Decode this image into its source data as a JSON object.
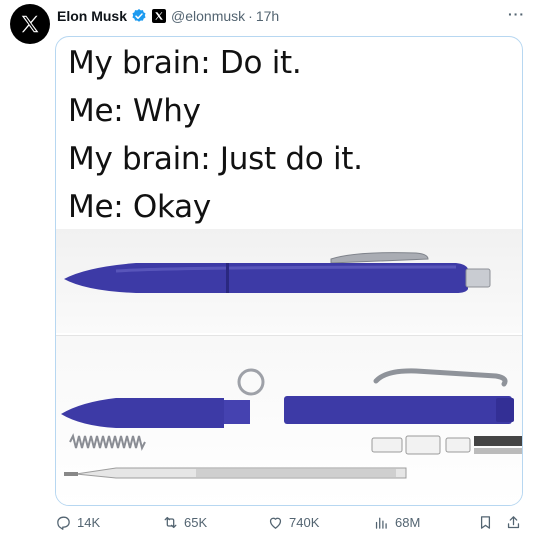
{
  "tweet": {
    "author_name": "Elon Musk",
    "handle": "@elonmusk",
    "separator": "·",
    "time": "17h",
    "more_label": "···"
  },
  "meme": {
    "lines": [
      "My brain: Do it.",
      "Me: Why",
      "My brain: Just do it.",
      "Me: Okay"
    ]
  },
  "actions": {
    "replies": "14K",
    "reposts": "65K",
    "likes": "740K",
    "views": "68M"
  },
  "colors": {
    "pen_blue": "#3d3aa6",
    "verified_blue": "#1d9bf0",
    "muted_text": "#536471"
  }
}
